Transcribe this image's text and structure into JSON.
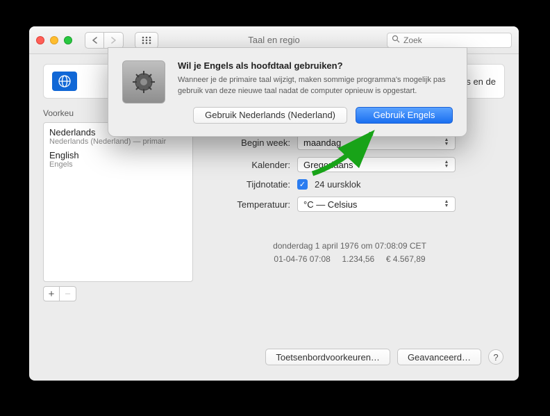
{
  "title": "Taal en regio",
  "search": {
    "placeholder": "Zoek"
  },
  "banner": {
    "text_suffix": "s en de"
  },
  "sidebar": {
    "section_label_prefix": "Voorkeu",
    "items": [
      {
        "name": "Nederlands",
        "sub": "Nederlands (Nederland) — primair"
      },
      {
        "name": "English",
        "sub": "Engels"
      }
    ]
  },
  "settings": {
    "begin_week": {
      "label": "Begin week:",
      "value": "maandag"
    },
    "calendar": {
      "label": "Kalender:",
      "value": "Gregoriaans"
    },
    "time_format": {
      "label": "Tijdnotatie:",
      "checkbox_label": "24 uursklok"
    },
    "temperature": {
      "label": "Temperatuur:",
      "value": "°C — Celsius"
    }
  },
  "examples": {
    "line1": "donderdag 1 april 1976 om 07:08:09 CET",
    "line2": "01-04-76 07:08     1.234,56     € 4.567,89"
  },
  "footer": {
    "keyboard_prefs": "Toetsenbordvoorkeuren…",
    "advanced": "Geavanceerd…"
  },
  "dialog": {
    "title": "Wil je Engels als hoofdtaal gebruiken?",
    "body": "Wanneer je de primaire taal wijzigt, maken sommige programma's mogelijk pas gebruik van deze nieuwe taal nadat de computer opnieuw is opgestart.",
    "secondary_button": "Gebruik Nederlands (Nederland)",
    "primary_button": "Gebruik Engels"
  }
}
